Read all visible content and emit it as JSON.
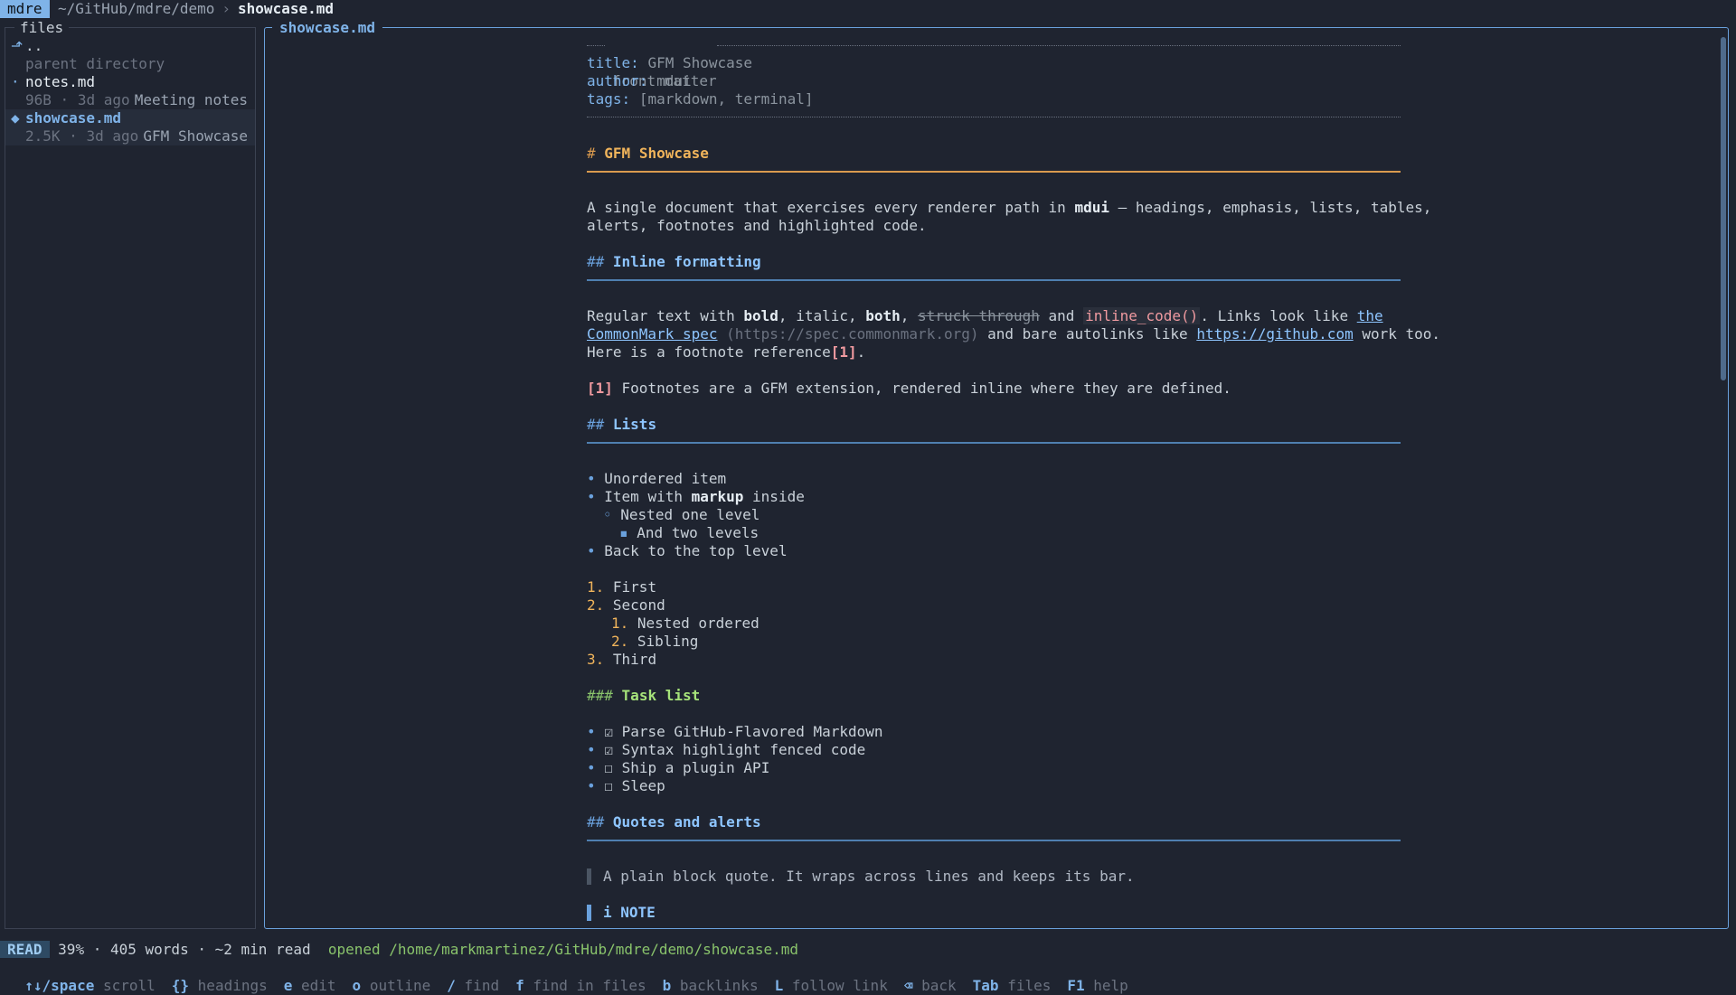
{
  "topbar": {
    "app": "mdre",
    "path": "~/GitHub/mdre/demo",
    "separator": "›",
    "file": "showcase.md"
  },
  "files": {
    "title": "files",
    "parent": {
      "glyph": "⬏",
      "name": "..",
      "meta": "parent directory"
    },
    "items": [
      {
        "glyph": "·",
        "name": "notes.md",
        "size": "96B",
        "dot": "·",
        "age": "3d ago",
        "desc": "Meeting notes"
      },
      {
        "glyph": "◆",
        "name": "showcase.md",
        "size": "2.5K",
        "dot": "·",
        "age": "3d ago",
        "desc": "GFM Showcase"
      }
    ]
  },
  "doc": {
    "title": "showcase.md",
    "front_matter": {
      "label": "front matter",
      "fields": [
        {
          "key": "title:",
          "value": "GFM Showcase"
        },
        {
          "key": "author:",
          "value": "mdui"
        },
        {
          "key": "tags:",
          "value": "[markdown, terminal]"
        }
      ]
    },
    "h1": {
      "mark": "#",
      "text": "GFM Showcase"
    },
    "intro": {
      "line1_a": "A single document that exercises every renderer path in ",
      "line1_bold": "mdui",
      "line1_b": " — headings, emphasis, lists, tables,",
      "line2": "alerts, footnotes and highlighted code."
    },
    "inline": {
      "mark": "##",
      "heading": "Inline formatting",
      "p1_a": "Regular text with ",
      "p1_bold": "bold",
      "p1_b": ", italic, ",
      "p1_both": "both",
      "p1_c": ", ",
      "p1_strike": "struck through",
      "p1_d": " and ",
      "p1_code": "inline_code()",
      "p1_e": ". Links look like ",
      "p1_link1": "the",
      "p2_link2": "CommonMark spec",
      "p2_url": " (https://spec.commonmark.org)",
      "p2_a": " and bare autolinks like ",
      "p2_autolink": "https://github.com",
      "p2_b": " work too.",
      "p3_a": "Here is a footnote reference",
      "p3_ref": "[1]",
      "p3_b": ".",
      "fn_ref": "[1]",
      "fn_text": " Footnotes are a GFM extension, rendered inline where they are defined."
    },
    "lists": {
      "mark": "##",
      "heading": "Lists",
      "unordered": [
        {
          "bullet": "•",
          "text": "Unordered item"
        },
        {
          "bullet": "•",
          "text_a": "Item with ",
          "bold": "markup",
          "text_b": " inside"
        },
        {
          "bullet": "◦",
          "text": "Nested one level"
        },
        {
          "bullet": "▪",
          "text": "And two levels"
        },
        {
          "bullet": "•",
          "text": "Back to the top level"
        }
      ],
      "ordered": [
        {
          "num": "1.",
          "text": "First"
        },
        {
          "num": "2.",
          "text": "Second"
        },
        {
          "num": "1.",
          "text": "Nested ordered"
        },
        {
          "num": "2.",
          "text": "Sibling"
        },
        {
          "num": "3.",
          "text": "Third"
        }
      ]
    },
    "tasks": {
      "mark": "###",
      "heading": "Task list",
      "items": [
        {
          "bullet": "•",
          "box": "☑",
          "text": "Parse GitHub-Flavored Markdown"
        },
        {
          "bullet": "•",
          "box": "☑",
          "text": "Syntax highlight fenced code"
        },
        {
          "bullet": "•",
          "box": "☐",
          "text": "Ship a plugin API"
        },
        {
          "bullet": "•",
          "box": "☐",
          "text": "Sleep"
        }
      ]
    },
    "quotes": {
      "mark": "##",
      "heading": "Quotes and alerts",
      "quote": "A plain block quote. It wraps across lines and keeps its bar.",
      "note": "i NOTE"
    },
    "scroll_percent": 39
  },
  "status": {
    "mode": "READ",
    "percent": "39%",
    "sep": "·",
    "words": "405 words",
    "read_time": "~2 min read",
    "message": "opened /home/markmartinez/GitHub/mdre/demo/showcase.md"
  },
  "hints": [
    {
      "key": "↑↓/space",
      "desc": "scroll"
    },
    {
      "key": "{}",
      "desc": "headings"
    },
    {
      "key": "e",
      "desc": "edit"
    },
    {
      "key": "o",
      "desc": "outline"
    },
    {
      "key": "/",
      "desc": "find"
    },
    {
      "key": "f",
      "desc": "find in files"
    },
    {
      "key": "b",
      "desc": "backlinks"
    },
    {
      "key": "L",
      "desc": "follow link"
    },
    {
      "key": "⌫",
      "desc": "back"
    },
    {
      "key": "Tab",
      "desc": "files"
    },
    {
      "key": "F1",
      "desc": "help"
    }
  ],
  "colors": {
    "accent": "#7fb3e8",
    "heading1": "#f0b45b",
    "heading2": "#8ec5ff",
    "heading3": "#a6e37a",
    "background": "#1f2430"
  }
}
